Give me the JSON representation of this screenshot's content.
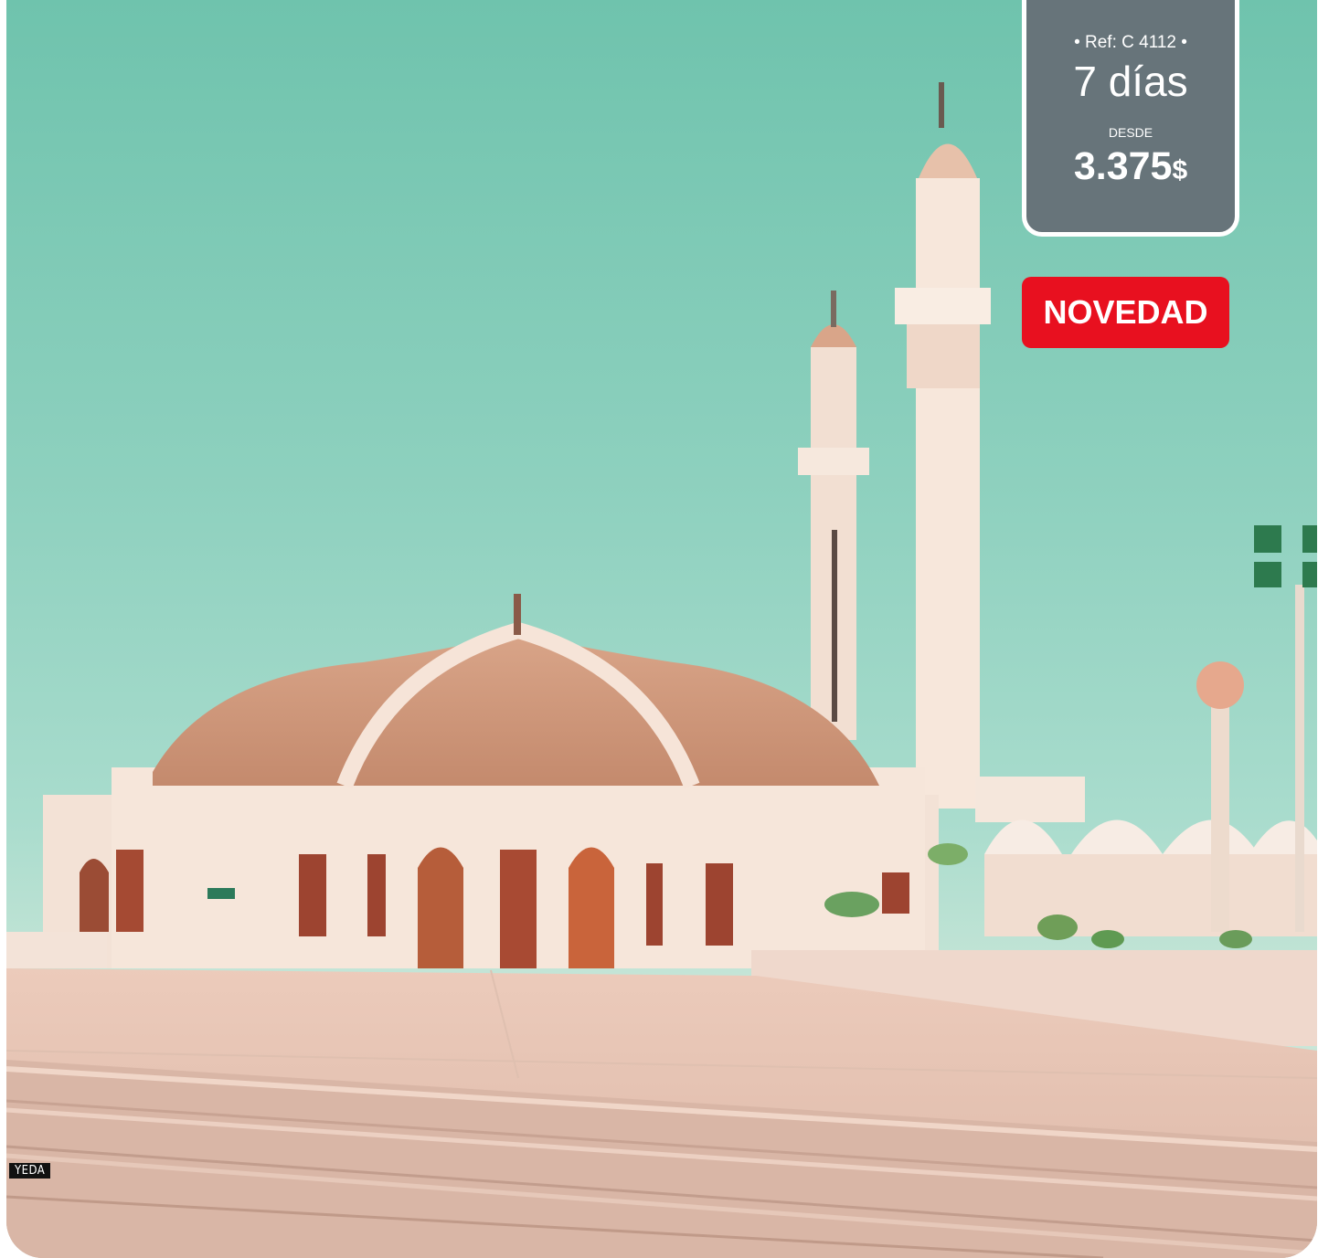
{
  "card": {
    "ref": "• Ref: C 4112 •",
    "duration": "7 días",
    "from_label": "DESDE",
    "price": "3.375",
    "currency": "$",
    "badge": "NOVEDAD",
    "location": "YEDA"
  },
  "colors": {
    "panel": "#67747a",
    "badge": "#e8101f",
    "sky": "#8fd1bf"
  }
}
